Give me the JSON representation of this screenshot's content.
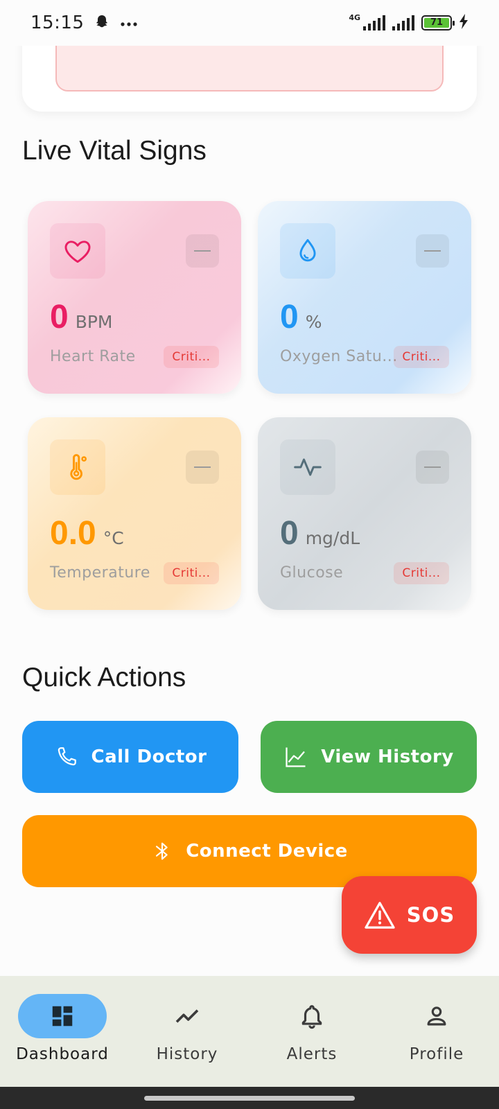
{
  "status_bar": {
    "time": "15:15",
    "network": "4G",
    "battery": "71"
  },
  "sections": {
    "vitals_title": "Live Vital Signs",
    "actions_title": "Quick Actions"
  },
  "vitals": {
    "heart": {
      "value": "0",
      "unit": "BPM",
      "label": "Heart Rate",
      "status": "Criti...",
      "icon": "heart-icon",
      "color": "#e91e63"
    },
    "oxygen": {
      "value": "0",
      "unit": "%",
      "label": "Oxygen Satu...",
      "status": "Criti...",
      "icon": "water-drop-icon",
      "color": "#2196f3"
    },
    "temperature": {
      "value": "0.0",
      "unit": "°C",
      "label": "Temperature",
      "status": "Criti...",
      "icon": "thermometer-icon",
      "color": "#ff9800"
    },
    "glucose": {
      "value": "0",
      "unit": "mg/dL",
      "label": "Glucose",
      "status": "Criti...",
      "icon": "pulse-icon",
      "color": "#546e7a"
    }
  },
  "actions": {
    "call_doctor": "Call Doctor",
    "view_history": "View History",
    "connect_device": "Connect Device",
    "sos": "SOS"
  },
  "nav": {
    "items": [
      {
        "label": "Dashboard",
        "icon": "dashboard-icon",
        "active": true
      },
      {
        "label": "History",
        "icon": "trend-icon",
        "active": false
      },
      {
        "label": "Alerts",
        "icon": "bell-icon",
        "active": false
      },
      {
        "label": "Profile",
        "icon": "person-icon",
        "active": false
      }
    ]
  },
  "colors": {
    "call": "#2196f3",
    "history": "#4caf50",
    "connect": "#ff9800",
    "sos": "#f44336",
    "nav_active": "#64b5f6",
    "nav_bg": "#eaede3"
  }
}
